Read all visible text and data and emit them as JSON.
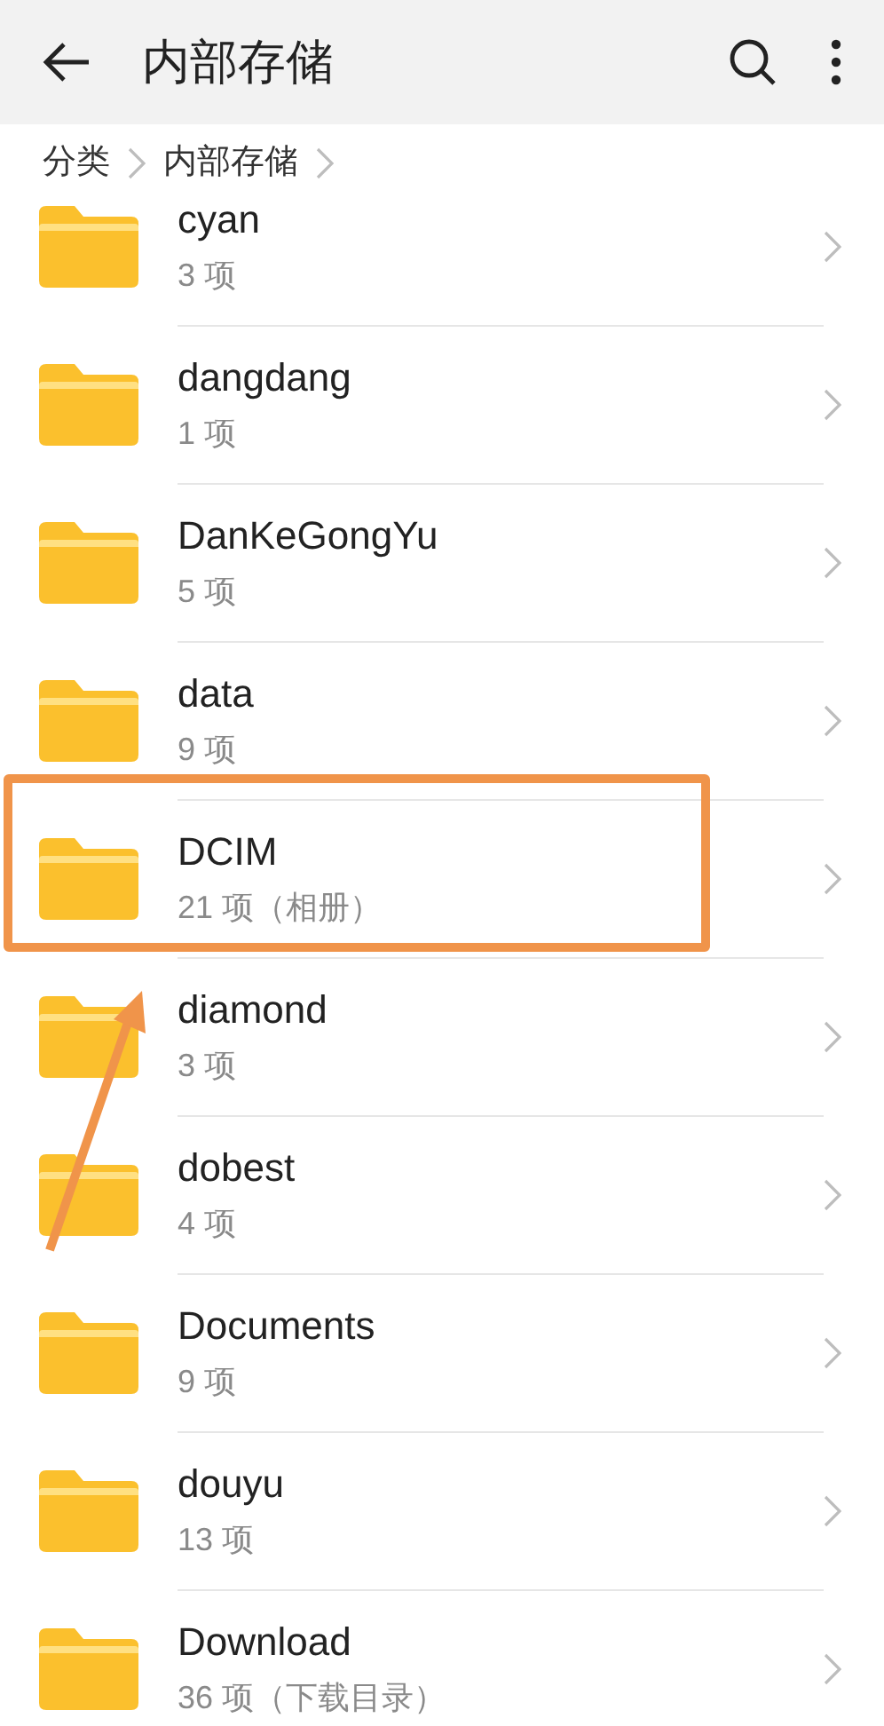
{
  "header": {
    "title": "内部存储"
  },
  "breadcrumb": [
    "分类",
    "内部存储"
  ],
  "folders": [
    {
      "name": "cyan",
      "count": "3 项",
      "highlighted": false
    },
    {
      "name": "dangdang",
      "count": "1 项",
      "highlighted": false
    },
    {
      "name": "DanKeGongYu",
      "count": "5 项",
      "highlighted": false
    },
    {
      "name": "data",
      "count": "9 项",
      "highlighted": false
    },
    {
      "name": "DCIM",
      "count": "21 项（相册）",
      "highlighted": true
    },
    {
      "name": "diamond",
      "count": "3 项",
      "highlighted": false
    },
    {
      "name": "dobest",
      "count": "4 项",
      "highlighted": false
    },
    {
      "name": "Documents",
      "count": "9 项",
      "highlighted": false
    },
    {
      "name": "douyu",
      "count": "13 项",
      "highlighted": false
    },
    {
      "name": "Download",
      "count": "36 项（下载目录）",
      "highlighted": false
    }
  ]
}
